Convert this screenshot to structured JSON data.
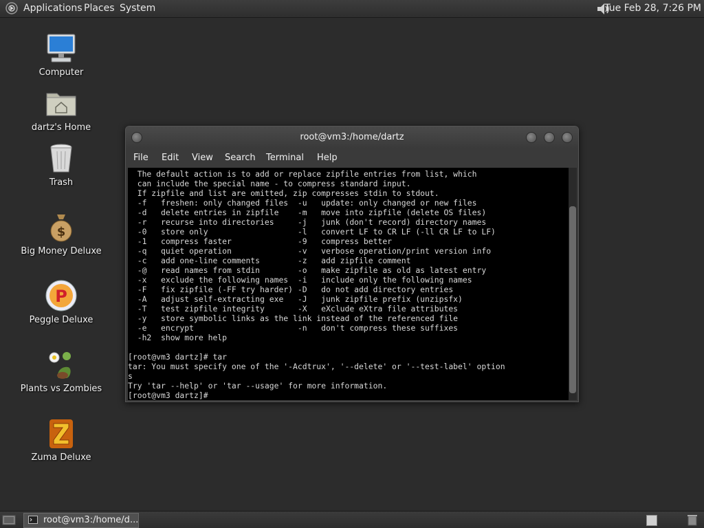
{
  "top_panel": {
    "menus": [
      "Applications",
      "Places",
      "System"
    ],
    "clock": "Tue Feb 28, 7:26 PM"
  },
  "desktop": {
    "icons": [
      {
        "label": "Computer",
        "icon": "computer-icon"
      },
      {
        "label": "dartz's Home",
        "icon": "home-folder-icon"
      },
      {
        "label": "Trash",
        "icon": "trash-icon"
      },
      {
        "label": "Big Money Deluxe",
        "icon": "money-bag-icon"
      },
      {
        "label": "Peggle Deluxe",
        "icon": "peggle-icon"
      },
      {
        "label": "Plants vs Zombies",
        "icon": "plants-vs-zombies-icon"
      },
      {
        "label": "Zuma Deluxe",
        "icon": "zuma-icon"
      }
    ]
  },
  "terminal": {
    "title": "root@vm3:/home/dartz",
    "menus": [
      "File",
      "Edit",
      "View",
      "Search",
      "Terminal",
      "Help"
    ],
    "lines": [
      "  The default action is to add or replace zipfile entries from list, which",
      "  can include the special name - to compress standard input.",
      "  If zipfile and list are omitted, zip compresses stdin to stdout.",
      "  -f   freshen: only changed files  -u   update: only changed or new files",
      "  -d   delete entries in zipfile    -m   move into zipfile (delete OS files)",
      "  -r   recurse into directories     -j   junk (don't record) directory names",
      "  -0   store only                   -l   convert LF to CR LF (-ll CR LF to LF)",
      "  -1   compress faster              -9   compress better",
      "  -q   quiet operation              -v   verbose operation/print version info",
      "  -c   add one-line comments        -z   add zipfile comment",
      "  -@   read names from stdin        -o   make zipfile as old as latest entry",
      "  -x   exclude the following names  -i   include only the following names",
      "  -F   fix zipfile (-FF try harder) -D   do not add directory entries",
      "  -A   adjust self-extracting exe   -J   junk zipfile prefix (unzipsfx)",
      "  -T   test zipfile integrity       -X   eXclude eXtra file attributes",
      "  -y   store symbolic links as the link instead of the referenced file",
      "  -e   encrypt                      -n   don't compress these suffixes",
      "  -h2  show more help",
      "",
      "[root@vm3 dartz]# tar",
      "tar: You must specify one of the '-Acdtrux', '--delete' or '--test-label' option",
      "s",
      "Try 'tar --help' or 'tar --usage' for more information.",
      "[root@vm3 dartz]# "
    ]
  },
  "bottom_panel": {
    "task_label": "root@vm3:/home/d..."
  },
  "colors": {
    "desktop_bg": "#2c2c2c",
    "terminal_bg": "#000000",
    "terminal_fg": "#d8d8d8"
  }
}
